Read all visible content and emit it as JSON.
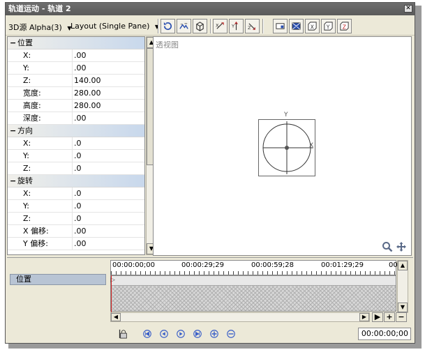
{
  "window": {
    "title": "轨道运动 - 轨道 2",
    "close_glyph": "✕"
  },
  "toolbar": {
    "source_dropdown": "3D源 Alpha(3)",
    "layout_dropdown": "Layout (Single Pane)",
    "dropdown_arrow": "▼",
    "buttons": [
      {
        "name": "rotate-icon",
        "label": ""
      },
      {
        "name": "blur-icon",
        "label": ""
      },
      {
        "name": "cube-3d-icon",
        "label": ""
      },
      {
        "name": "axis-x-icon",
        "label": "X"
      },
      {
        "name": "axis-y-icon",
        "label": "Y"
      },
      {
        "name": "axis-z-icon",
        "label": "Z"
      },
      {
        "name": "pane-single-icon",
        "label": ""
      },
      {
        "name": "envelope-icon",
        "label": ""
      },
      {
        "name": "x-button-icon",
        "label": "X"
      },
      {
        "name": "y-button-icon",
        "label": "Y"
      },
      {
        "name": "z-button-icon",
        "label": "Z"
      }
    ]
  },
  "properties": {
    "sections": [
      {
        "label": "位置",
        "rows": [
          {
            "key": "X:",
            "value": ".00"
          },
          {
            "key": "Y:",
            "value": ".00"
          },
          {
            "key": "Z:",
            "value": "140.00"
          },
          {
            "key": "宽度:",
            "value": "280.00"
          },
          {
            "key": "高度:",
            "value": "280.00"
          },
          {
            "key": "深度:",
            "value": ".00"
          }
        ]
      },
      {
        "label": "方向",
        "rows": [
          {
            "key": "X:",
            "value": ".0"
          },
          {
            "key": "Y:",
            "value": ".0"
          },
          {
            "key": "Z:",
            "value": ".0"
          }
        ]
      },
      {
        "label": "旋转",
        "rows": [
          {
            "key": "X:",
            "value": ".0"
          },
          {
            "key": "Y:",
            "value": ".0"
          },
          {
            "key": "Z:",
            "value": ".0"
          },
          {
            "key": "X 偏移:",
            "value": ".00"
          },
          {
            "key": "Y 偏移:",
            "value": ".00"
          }
        ]
      }
    ]
  },
  "viewport": {
    "title": "透视图",
    "axis_y": "Y",
    "axis_x": "X"
  },
  "timeline": {
    "track_label": "位置",
    "ruler_marks": [
      "00:00:00;00",
      "00:00:29;29",
      "00:00:59;28",
      "00:01:29;29",
      "00"
    ],
    "timecode": "00:00:00;00",
    "zoom_in": "+",
    "zoom_out": "−"
  },
  "icons": {
    "scroll_up": "▲",
    "scroll_down": "▼",
    "scroll_left": "◀",
    "scroll_right": "▶",
    "keyframe": "▷"
  },
  "colors": {
    "titlebar": "#5f5f5f",
    "section_gradient_end": "#c8d8ec",
    "cursor": "#d02020",
    "nav_icon": "#3a5fc8"
  }
}
